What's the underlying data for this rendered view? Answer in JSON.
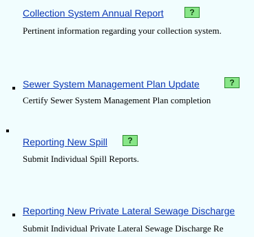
{
  "items": [
    {
      "link_text": "Collection System Annual Report",
      "description": "Pertinent information regarding your collection system.",
      "help_label": "?"
    },
    {
      "link_text": "Sewer System Management Plan Update",
      "description": "Certify Sewer System Management Plan completion",
      "help_label": "?"
    },
    {
      "link_text": "Reporting New Spill",
      "description": "Submit Individual Spill Reports.",
      "help_label": "?"
    },
    {
      "link_text": "Reporting New Private Lateral Sewage Discharge",
      "description": "Submit Individual Private Lateral Sewage Discharge Re"
    }
  ]
}
